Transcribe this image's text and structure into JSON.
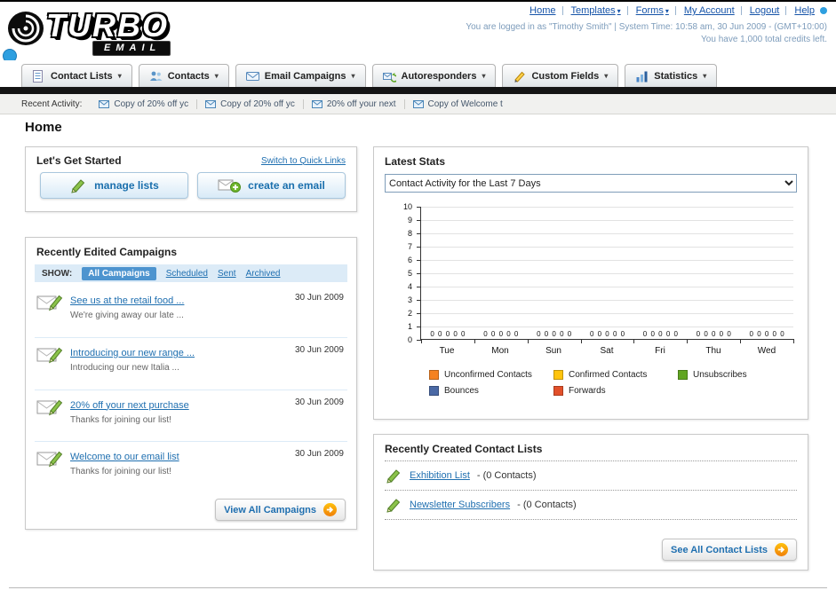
{
  "header": {
    "logo_main": "TURBO",
    "logo_sub": "EMAIL",
    "top_links": [
      {
        "label": "Home"
      },
      {
        "label": "Templates"
      },
      {
        "label": "Forms"
      },
      {
        "label": "My Account"
      },
      {
        "label": "Logout"
      },
      {
        "label": "Help"
      }
    ],
    "login_info": "You are logged in as \"Timothy Smith\" | System Time: 10:58 am, 30 Jun 2009 - (GMT+10:00)",
    "credits_info": "You have 1,000 total credits left."
  },
  "nav": {
    "items": [
      {
        "label": "Contact Lists",
        "icon": "contact-lists-icon"
      },
      {
        "label": "Contacts",
        "icon": "contacts-icon"
      },
      {
        "label": "Email Campaigns",
        "icon": "email-campaigns-icon"
      },
      {
        "label": "Autoresponders",
        "icon": "autoresponders-icon"
      },
      {
        "label": "Custom Fields",
        "icon": "custom-fields-icon"
      },
      {
        "label": "Statistics",
        "icon": "statistics-icon"
      }
    ]
  },
  "recent_activity": {
    "label": "Recent Activity:",
    "items": [
      {
        "label": "Copy of 20% off yc"
      },
      {
        "label": "Copy of 20% off yc"
      },
      {
        "label": "20% off your next"
      },
      {
        "label": "Copy of Welcome t"
      }
    ]
  },
  "page": {
    "title": "Home"
  },
  "get_started": {
    "title": "Let's Get Started",
    "switch_link": "Switch to Quick Links",
    "manage_lists_button": "manage lists",
    "create_email_button": "create an email"
  },
  "campaigns": {
    "title": "Recently Edited Campaigns",
    "show_label": "SHOW:",
    "tabs": [
      {
        "label": "All Campaigns",
        "selected": true
      },
      {
        "label": "Scheduled",
        "selected": false
      },
      {
        "label": "Sent",
        "selected": false
      },
      {
        "label": "Archived",
        "selected": false
      }
    ],
    "items": [
      {
        "title": "See us at the retail food ...",
        "subtitle": "We're giving away our late ...",
        "date": "30 Jun 2009"
      },
      {
        "title": "Introducing our new range ...",
        "subtitle": "Introducing our new Italia ...",
        "date": "30 Jun 2009"
      },
      {
        "title": "20% off your next purchase",
        "subtitle": "Thanks for joining our list!",
        "date": "30 Jun 2009"
      },
      {
        "title": "Welcome to our email list",
        "subtitle": "Thanks for joining our list!",
        "date": "30 Jun 2009"
      }
    ],
    "view_all_button": "View All Campaigns"
  },
  "stats": {
    "title": "Latest Stats",
    "range_selected": "Contact Activity for the Last 7 Days",
    "chart_data": {
      "type": "bar",
      "categories": [
        "Tue",
        "Mon",
        "Sun",
        "Sat",
        "Fri",
        "Thu",
        "Wed"
      ],
      "series": [
        {
          "name": "Unconfirmed Contacts",
          "color": "#f58220",
          "values": [
            0,
            0,
            0,
            0,
            0,
            0,
            0
          ]
        },
        {
          "name": "Confirmed Contacts",
          "color": "#ffc40d",
          "values": [
            0,
            0,
            0,
            0,
            0,
            0,
            0
          ]
        },
        {
          "name": "Unsubscribes",
          "color": "#61a521",
          "values": [
            0,
            0,
            0,
            0,
            0,
            0,
            0
          ]
        },
        {
          "name": "Bounces",
          "color": "#4a69a5",
          "values": [
            0,
            0,
            0,
            0,
            0,
            0,
            0
          ]
        },
        {
          "name": "Forwards",
          "color": "#e2502a",
          "values": [
            0,
            0,
            0,
            0,
            0,
            0,
            0
          ]
        }
      ],
      "ylim": [
        0,
        10
      ],
      "yticks": [
        0,
        1,
        2,
        3,
        4,
        5,
        6,
        7,
        8,
        9,
        10
      ],
      "grid": true,
      "legend_position": "bottom"
    }
  },
  "contact_lists": {
    "title": "Recently Created Contact Lists",
    "items": [
      {
        "name": "Exhibition List",
        "suffix": "- (0 Contacts)"
      },
      {
        "name": "Newsletter Subscribers",
        "suffix": "- (0 Contacts)"
      }
    ],
    "see_all_button": "See All Contact Lists"
  },
  "colors": {
    "link": "#1f6fb0",
    "accent_orange": "#f58816",
    "nav_bar": "#141414",
    "panel_border": "#c9c9c9"
  }
}
